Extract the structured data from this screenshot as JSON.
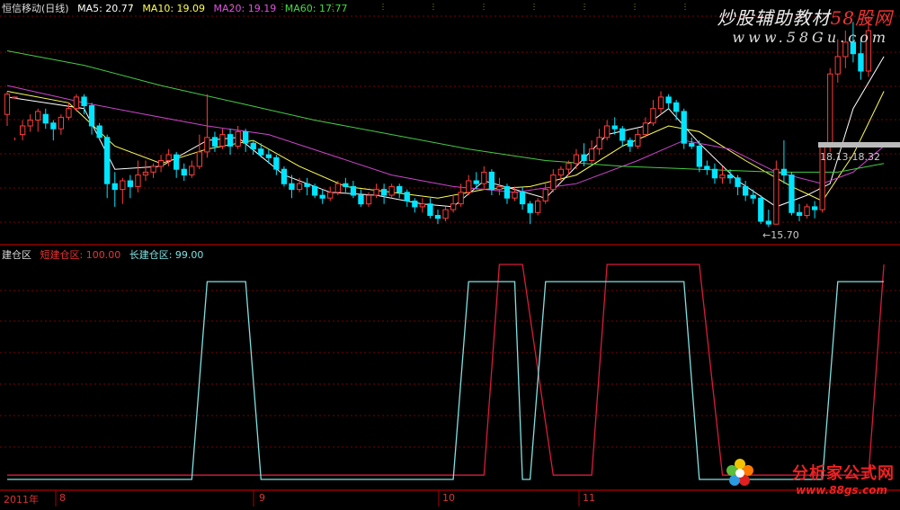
{
  "header_top": {
    "title": "恒信移动(日线)",
    "ma5": "MA5: 20.77",
    "ma10": "MA10: 19.09",
    "ma20": "MA20: 19.19",
    "ma60": "MA60: 17.77"
  },
  "header_bottom": {
    "title": "建仓区",
    "short": "短建仓区: 100.00",
    "long": "长建仓区: 99.00"
  },
  "watermark": {
    "line1_a": "炒股辅助教材",
    "line1_b": "58股网",
    "line2": "www.58Gu.com",
    "footer_cn": "分析家公式网",
    "footer_url": "www.88gs.com"
  },
  "annotations": {
    "low": "←15.70",
    "range": "18.13-18.32"
  },
  "date_axis": [
    "2011年",
    "8",
    "9",
    "10",
    "11"
  ],
  "colors": {
    "up": "#ff3b3b",
    "down": "#00e5ff",
    "ma5": "#ffffff",
    "ma10": "#ffff55",
    "ma20": "#cc44cc",
    "ma60": "#44cc44",
    "short_zone": "#d81b3b",
    "long_zone": "#80e0e0",
    "grid": "#7a0000"
  },
  "chart_data": [
    {
      "type": "candlestick",
      "title": "恒信移动(日线)",
      "ylim": [
        15.2,
        22.8
      ],
      "candles": [
        [
          19.4,
          20.1,
          19.0,
          20.2
        ],
        [
          20.0,
          20.0,
          18.6,
          18.5
        ],
        [
          18.7,
          19.0,
          18.5,
          19.2
        ],
        [
          19.0,
          19.2,
          18.8,
          19.4
        ],
        [
          19.2,
          19.5,
          18.8,
          19.6
        ],
        [
          19.4,
          19.1,
          18.9,
          19.6
        ],
        [
          19.1,
          18.9,
          18.5,
          19.2
        ],
        [
          18.9,
          19.3,
          18.7,
          19.4
        ],
        [
          19.3,
          19.6,
          19.2,
          19.8
        ],
        [
          19.6,
          20.0,
          19.5,
          20.1
        ],
        [
          20.0,
          19.7,
          19.4,
          20.1
        ],
        [
          19.7,
          19.0,
          18.7,
          19.8
        ],
        [
          19.0,
          18.6,
          18.5,
          19.1
        ],
        [
          18.6,
          17.0,
          16.5,
          18.7
        ],
        [
          17.0,
          16.8,
          16.2,
          17.4
        ],
        [
          16.8,
          17.1,
          16.3,
          17.2
        ],
        [
          17.1,
          16.9,
          16.5,
          17.3
        ],
        [
          16.9,
          17.3,
          16.7,
          17.8
        ],
        [
          17.3,
          17.4,
          17.1,
          17.8
        ],
        [
          17.4,
          17.6,
          17.2,
          17.7
        ],
        [
          17.6,
          17.8,
          17.4,
          18.0
        ],
        [
          17.8,
          18.0,
          17.6,
          18.2
        ],
        [
          18.0,
          17.5,
          17.2,
          18.1
        ],
        [
          17.5,
          17.3,
          17.1,
          17.7
        ],
        [
          17.3,
          17.6,
          17.2,
          17.8
        ],
        [
          17.6,
          18.1,
          17.5,
          18.7
        ],
        [
          18.1,
          18.6,
          17.9,
          20.1
        ],
        [
          18.6,
          18.3,
          18.1,
          18.8
        ],
        [
          18.3,
          18.7,
          18.2,
          18.9
        ],
        [
          18.7,
          18.3,
          18.0,
          18.9
        ],
        [
          18.3,
          18.8,
          18.2,
          19.0
        ],
        [
          18.8,
          18.4,
          18.1,
          18.9
        ],
        [
          18.4,
          18.2,
          18.0,
          18.5
        ],
        [
          18.2,
          18.0,
          17.9,
          18.4
        ],
        [
          18.0,
          17.9,
          17.7,
          18.2
        ],
        [
          17.9,
          17.5,
          17.3,
          18.0
        ],
        [
          17.5,
          17.0,
          16.9,
          17.6
        ],
        [
          17.0,
          16.8,
          16.5,
          17.3
        ],
        [
          16.8,
          17.0,
          16.7,
          17.2
        ],
        [
          17.0,
          16.9,
          16.6,
          17.2
        ],
        [
          16.9,
          16.6,
          16.5,
          17.0
        ],
        [
          16.6,
          16.5,
          16.3,
          16.8
        ],
        [
          16.5,
          16.7,
          16.4,
          16.9
        ],
        [
          16.7,
          17.0,
          16.6,
          17.1
        ],
        [
          17.0,
          16.9,
          16.7,
          17.2
        ],
        [
          16.9,
          16.6,
          16.5,
          17.1
        ],
        [
          16.6,
          16.3,
          16.2,
          16.8
        ],
        [
          16.3,
          16.6,
          16.2,
          16.7
        ],
        [
          16.6,
          16.8,
          16.5,
          17.0
        ],
        [
          16.8,
          16.6,
          16.3,
          17.0
        ],
        [
          16.6,
          16.9,
          16.5,
          17.0
        ],
        [
          16.9,
          16.7,
          16.5,
          17.0
        ],
        [
          16.7,
          16.4,
          16.2,
          16.8
        ],
        [
          16.4,
          16.2,
          16.0,
          16.5
        ],
        [
          16.2,
          16.3,
          16.0,
          16.5
        ],
        [
          16.3,
          15.9,
          15.8,
          16.5
        ],
        [
          15.9,
          15.8,
          15.6,
          16.1
        ],
        [
          15.8,
          16.1,
          15.7,
          16.2
        ],
        [
          16.1,
          16.3,
          16.0,
          16.6
        ],
        [
          16.3,
          16.7,
          16.2,
          17.0
        ],
        [
          16.7,
          17.1,
          16.6,
          17.3
        ],
        [
          17.1,
          17.0,
          16.8,
          17.4
        ],
        [
          17.0,
          17.4,
          16.8,
          17.6
        ],
        [
          17.4,
          16.8,
          16.6,
          17.5
        ],
        [
          16.8,
          16.9,
          16.6,
          17.2
        ],
        [
          16.9,
          16.5,
          16.3,
          17.0
        ],
        [
          16.5,
          16.7,
          16.4,
          16.9
        ],
        [
          16.7,
          16.3,
          16.1,
          16.9
        ],
        [
          16.3,
          16.0,
          15.6,
          16.4
        ],
        [
          16.0,
          16.4,
          15.9,
          16.5
        ],
        [
          16.4,
          16.8,
          16.3,
          17.0
        ],
        [
          16.8,
          17.3,
          16.7,
          17.5
        ],
        [
          17.3,
          17.5,
          17.1,
          17.6
        ],
        [
          17.5,
          17.7,
          17.3,
          17.8
        ],
        [
          17.7,
          18.0,
          17.5,
          18.2
        ],
        [
          18.0,
          17.8,
          17.6,
          18.4
        ],
        [
          17.8,
          18.2,
          17.7,
          18.5
        ],
        [
          18.2,
          18.6,
          18.0,
          18.9
        ],
        [
          18.6,
          19.0,
          18.5,
          19.2
        ],
        [
          19.0,
          18.9,
          18.7,
          19.3
        ],
        [
          18.9,
          18.5,
          18.3,
          19.0
        ],
        [
          18.5,
          18.3,
          18.1,
          18.6
        ],
        [
          18.3,
          18.7,
          18.2,
          18.9
        ],
        [
          18.7,
          19.1,
          18.6,
          19.3
        ],
        [
          19.1,
          19.6,
          19.0,
          19.9
        ],
        [
          19.6,
          20.0,
          19.4,
          20.2
        ],
        [
          20.0,
          19.8,
          19.6,
          20.1
        ],
        [
          19.8,
          19.5,
          19.2,
          19.9
        ],
        [
          19.5,
          18.4,
          18.2,
          19.6
        ],
        [
          18.4,
          18.3,
          18.2,
          18.6
        ],
        [
          18.3,
          17.6,
          17.4,
          18.5
        ],
        [
          17.6,
          17.5,
          17.3,
          17.8
        ],
        [
          17.5,
          17.2,
          17.0,
          17.7
        ],
        [
          17.2,
          17.3,
          17.0,
          17.6
        ],
        [
          17.3,
          17.2,
          17.0,
          17.5
        ],
        [
          17.2,
          16.9,
          16.6,
          17.3
        ],
        [
          16.9,
          16.6,
          16.4,
          17.1
        ],
        [
          16.6,
          16.5,
          16.3,
          16.8
        ],
        [
          16.5,
          15.7,
          15.6,
          16.6
        ],
        [
          15.7,
          15.6,
          15.5,
          16.1
        ],
        [
          15.6,
          17.5,
          17.2,
          17.8
        ],
        [
          17.5,
          17.3,
          17.0,
          18.5
        ],
        [
          17.3,
          16.0,
          15.9,
          17.4
        ],
        [
          16.0,
          15.9,
          15.7,
          16.3
        ],
        [
          15.9,
          16.2,
          15.8,
          16.3
        ],
        [
          16.2,
          16.1,
          15.8,
          16.4
        ],
        [
          16.1,
          18.3,
          16.0,
          18.4
        ],
        [
          18.3,
          20.8,
          18.1,
          21.0
        ],
        [
          20.8,
          21.4,
          20.5,
          22.0
        ],
        [
          21.4,
          21.9,
          21.0,
          22.3
        ],
        [
          21.9,
          21.5,
          21.2,
          22.6
        ],
        [
          21.5,
          20.9,
          20.6,
          22.0
        ],
        [
          20.9,
          22.3,
          20.7,
          22.8
        ]
      ],
      "ma": {
        "ma5": [
          [
            0,
            20.0
          ],
          [
            10,
            19.6
          ],
          [
            14,
            17.5
          ],
          [
            20,
            17.6
          ],
          [
            26,
            18.5
          ],
          [
            30,
            18.6
          ],
          [
            36,
            17.3
          ],
          [
            42,
            16.7
          ],
          [
            48,
            16.6
          ],
          [
            54,
            16.3
          ],
          [
            58,
            16.2
          ],
          [
            62,
            17.1
          ],
          [
            66,
            16.8
          ],
          [
            70,
            16.5
          ],
          [
            74,
            17.6
          ],
          [
            78,
            18.7
          ],
          [
            83,
            19.0
          ],
          [
            86,
            19.6
          ],
          [
            90,
            18.4
          ],
          [
            95,
            17.1
          ],
          [
            100,
            16.2
          ],
          [
            104,
            16.6
          ],
          [
            107,
            17.0
          ],
          [
            110,
            19.6
          ],
          [
            114,
            21.4
          ]
        ],
        "ma10": [
          [
            0,
            20.2
          ],
          [
            8,
            19.8
          ],
          [
            14,
            18.3
          ],
          [
            20,
            17.7
          ],
          [
            26,
            18.2
          ],
          [
            32,
            18.5
          ],
          [
            38,
            17.6
          ],
          [
            44,
            16.9
          ],
          [
            50,
            16.7
          ],
          [
            56,
            16.5
          ],
          [
            62,
            16.8
          ],
          [
            68,
            16.9
          ],
          [
            74,
            17.3
          ],
          [
            80,
            18.3
          ],
          [
            86,
            19.0
          ],
          [
            90,
            18.8
          ],
          [
            96,
            17.8
          ],
          [
            102,
            16.9
          ],
          [
            106,
            16.4
          ],
          [
            110,
            18.0
          ],
          [
            114,
            20.2
          ]
        ],
        "ma20": [
          [
            0,
            20.4
          ],
          [
            10,
            19.8
          ],
          [
            18,
            19.4
          ],
          [
            26,
            19.0
          ],
          [
            34,
            18.7
          ],
          [
            42,
            18.0
          ],
          [
            50,
            17.3
          ],
          [
            58,
            16.9
          ],
          [
            66,
            16.7
          ],
          [
            74,
            17.0
          ],
          [
            82,
            17.8
          ],
          [
            88,
            18.5
          ],
          [
            94,
            18.2
          ],
          [
            100,
            17.4
          ],
          [
            106,
            17.0
          ],
          [
            110,
            17.4
          ],
          [
            114,
            18.3
          ]
        ],
        "ma60": [
          [
            0,
            21.6
          ],
          [
            10,
            21.1
          ],
          [
            20,
            20.4
          ],
          [
            30,
            19.8
          ],
          [
            40,
            19.2
          ],
          [
            50,
            18.7
          ],
          [
            60,
            18.2
          ],
          [
            70,
            17.8
          ],
          [
            80,
            17.6
          ],
          [
            90,
            17.5
          ],
          [
            100,
            17.4
          ],
          [
            108,
            17.4
          ],
          [
            114,
            17.7
          ]
        ]
      }
    },
    {
      "type": "line",
      "title": "建仓区",
      "ylim": [
        0,
        100
      ],
      "series": [
        {
          "name": "短建仓区",
          "points": [
            [
              0,
              2
            ],
            [
              62,
              2
            ],
            [
              64,
              100
            ],
            [
              67,
              100
            ],
            [
              71,
              2
            ],
            [
              76,
              2
            ],
            [
              78,
              100
            ],
            [
              90,
              100
            ],
            [
              93,
              2
            ],
            [
              112,
              2
            ],
            [
              114,
              100
            ]
          ]
        },
        {
          "name": "长建仓区",
          "points": [
            [
              0,
              0
            ],
            [
              24,
              0
            ],
            [
              26,
              92
            ],
            [
              31,
              92
            ],
            [
              33,
              0
            ],
            [
              58,
              0
            ],
            [
              60,
              92
            ],
            [
              66,
              92
            ],
            [
              67,
              0
            ],
            [
              68,
              0
            ],
            [
              70,
              92
            ],
            [
              88,
              92
            ],
            [
              90,
              0
            ],
            [
              106,
              0
            ],
            [
              108,
              92
            ],
            [
              114,
              92
            ]
          ]
        }
      ]
    }
  ]
}
